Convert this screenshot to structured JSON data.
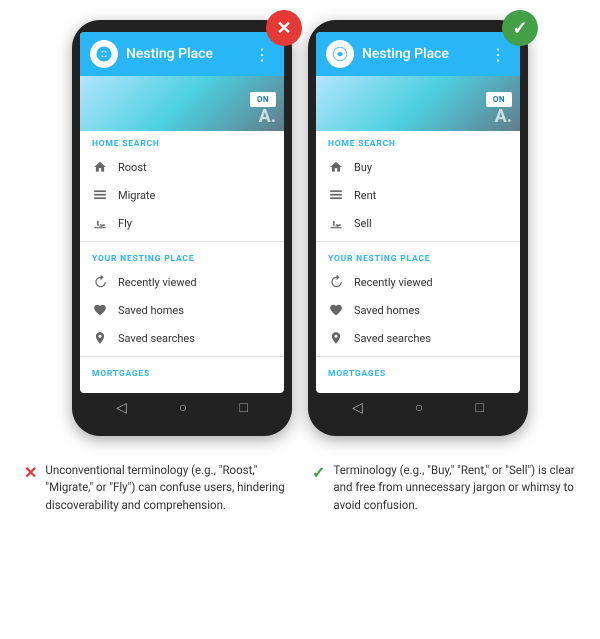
{
  "left": {
    "badge": "✕",
    "badge_type": "bad",
    "app_title": "Nesting Place",
    "home_search_label": "HOME SEARCH",
    "menu_items_search": [
      {
        "icon": "home",
        "label": "Roost"
      },
      {
        "icon": "grid",
        "label": "Migrate"
      },
      {
        "icon": "fly",
        "label": "Fly"
      }
    ],
    "your_section_label": "YOUR NESTING PLACE",
    "menu_items_yours": [
      {
        "icon": "recent",
        "label": "Recently viewed"
      },
      {
        "icon": "heart",
        "label": "Saved homes"
      },
      {
        "icon": "pin",
        "label": "Saved searches"
      }
    ],
    "mortgages_label": "MORTGAGES",
    "caption_icon": "✕",
    "caption_type": "bad",
    "caption_text": "Unconventional terminology (e.g., \"Roost,\" \"Migrate,\" or \"Fly\") can confuse users, hindering discoverability and comprehension."
  },
  "right": {
    "badge": "✓",
    "badge_type": "good",
    "app_title": "Nesting Place",
    "home_search_label": "HOME SEARCH",
    "menu_items_search": [
      {
        "icon": "home",
        "label": "Buy"
      },
      {
        "icon": "grid",
        "label": "Rent"
      },
      {
        "icon": "fly",
        "label": "Sell"
      }
    ],
    "your_section_label": "YOUR NESTING PLACE",
    "menu_items_yours": [
      {
        "icon": "recent",
        "label": "Recently viewed"
      },
      {
        "icon": "heart",
        "label": "Saved homes"
      },
      {
        "icon": "pin",
        "label": "Saved searches"
      }
    ],
    "mortgages_label": "MORTGAGES",
    "caption_icon": "✓",
    "caption_type": "good",
    "caption_text": "Terminology (e.g., \"Buy,\" \"Rent,\" or \"Sell\") is clear and free from unnecessary jargon or whimsy to avoid confusion."
  }
}
